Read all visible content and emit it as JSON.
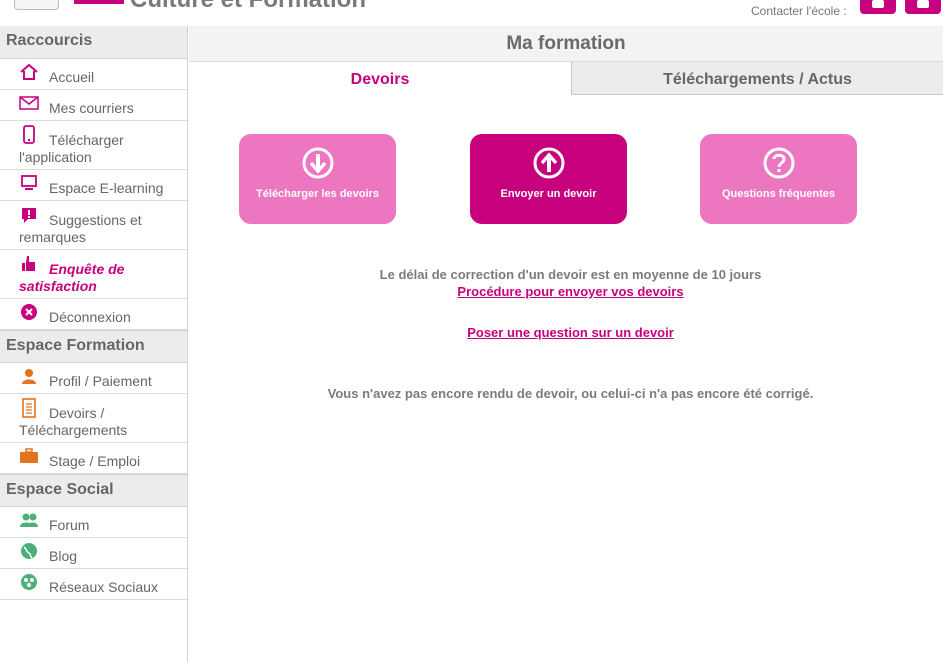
{
  "header": {
    "brand": "Culture et Formation",
    "contact_label": "Contacter l'école :",
    "phone_icon": "phone-icon",
    "mail_icon": "mail-icon",
    "accent_color": "#c7007d"
  },
  "sidebar": {
    "sections": [
      {
        "title": "Raccourcis",
        "items": [
          {
            "label": "Accueil",
            "icon": "home-icon"
          },
          {
            "label": "Mes courriers",
            "icon": "envelope-icon"
          },
          {
            "label": "Télécharger l'application",
            "icon": "mobile-icon"
          },
          {
            "label": "Espace E-learning",
            "icon": "monitor-icon"
          },
          {
            "label": "Suggestions et remarques",
            "icon": "comment-alert-icon"
          },
          {
            "label": "Enquête de satisfaction",
            "icon": "thumbs-up-icon",
            "active": true
          },
          {
            "label": "Déconnexion",
            "icon": "close-circle-icon"
          }
        ]
      },
      {
        "title": "Espace Formation",
        "items": [
          {
            "label": "Profil / Paiement",
            "icon": "user-icon"
          },
          {
            "label": "Devoirs / Téléchargements",
            "icon": "document-icon"
          },
          {
            "label": "Stage / Emploi",
            "icon": "briefcase-icon"
          }
        ]
      },
      {
        "title": "Espace Social",
        "items": [
          {
            "label": "Forum",
            "icon": "users-icon"
          },
          {
            "label": "Blog",
            "icon": "globe-icon"
          },
          {
            "label": "Réseaux Sociaux",
            "icon": "network-icon"
          }
        ]
      }
    ]
  },
  "main": {
    "title": "Ma formation",
    "tabs": [
      {
        "label": "Devoirs",
        "active": true
      },
      {
        "label": "Téléchargements / Actus",
        "active": false
      }
    ],
    "actions": [
      {
        "label": "Télécharger les devoirs",
        "icon": "download-circle-icon"
      },
      {
        "label": "Envoyer un devoir",
        "icon": "upload-circle-icon"
      },
      {
        "label": "Questions fréquentes",
        "icon": "question-circle-icon"
      }
    ],
    "delay_text": "Le délai de correction d'un devoir est en moyenne de 10 jours",
    "procedure_link": "Procédure pour envoyer vos devoirs",
    "question_link": "Poser une question sur un devoir",
    "status_text": "Vous n'avez pas encore rendu de devoir, ou celui-ci n'a pas encore été corrigé."
  }
}
